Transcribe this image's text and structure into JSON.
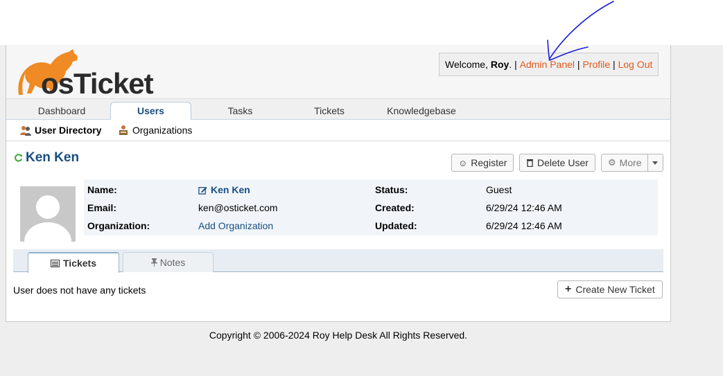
{
  "header": {
    "logo_text": "osTicket",
    "welcome_prefix": "Welcome,",
    "welcome_user": "Roy",
    "welcome_suffix": ". |",
    "admin_panel": "Admin Panel",
    "profile": "Profile",
    "logout": "Log Out",
    "sep": "|"
  },
  "nav": {
    "tabs": [
      "Dashboard",
      "Users",
      "Tasks",
      "Tickets",
      "Knowledgebase"
    ],
    "active": "Users"
  },
  "subnav": {
    "user_directory": "User Directory",
    "organizations": "Organizations"
  },
  "user": {
    "name": "Ken Ken",
    "register": "Register",
    "delete": "Delete User",
    "more": "More",
    "fields": {
      "name_label": "Name:",
      "name_value": "Ken Ken",
      "email_label": "Email:",
      "email_value": "ken@osticket.com",
      "org_label": "Organization:",
      "org_value": "Add Organization",
      "status_label": "Status:",
      "status_value": "Guest",
      "created_label": "Created:",
      "created_value": "6/29/24 12:46 AM",
      "updated_label": "Updated:",
      "updated_value": "6/29/24 12:46 AM"
    }
  },
  "tabs": {
    "tickets": "Tickets",
    "notes": "Notes"
  },
  "tickets_panel": {
    "empty_text": "User does not have any tickets",
    "create_button": "Create New Ticket"
  },
  "footer": {
    "copyright": "Copyright © 2006-2024 Roy Help Desk All Rights Reserved."
  },
  "colors": {
    "link_orange": "#e05a1c",
    "link_blue": "#184e81",
    "annotation_ink": "#1a1fd6"
  },
  "icons": [
    "refresh-icon",
    "smiley-icon",
    "trash-icon",
    "gear-icon",
    "caret-down-icon",
    "edit-icon",
    "list-icon",
    "pin-icon",
    "plus-icon",
    "users-icon",
    "organization-icon"
  ]
}
